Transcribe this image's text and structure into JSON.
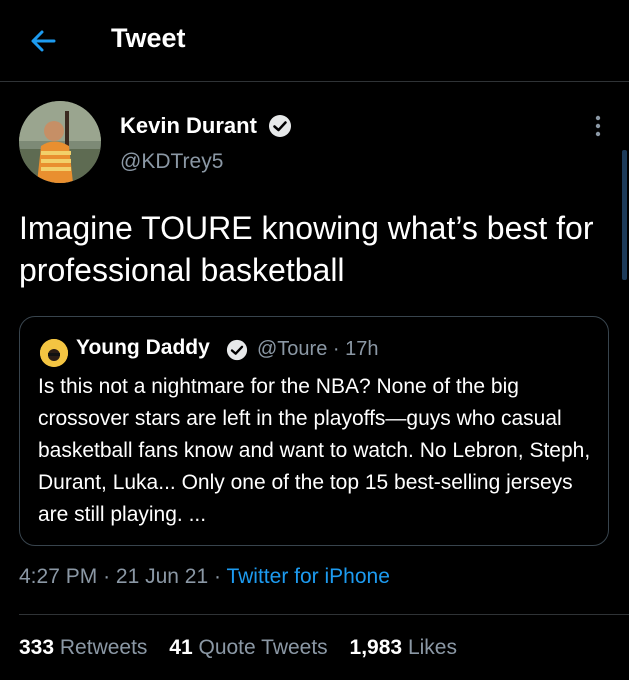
{
  "header": {
    "title": "Tweet",
    "back_icon": "arrow-left-icon",
    "accent_color": "#1d9bf0"
  },
  "author": {
    "name": "Kevin Durant",
    "handle": "@KDTrey5",
    "verified": true
  },
  "tweet": {
    "text": "Imagine TOURE knowing what’s best for professional basketball"
  },
  "quote": {
    "name": "Young Daddy",
    "verified": true,
    "handle": "@Toure",
    "separator": "·",
    "time": "17h",
    "text": "Is this not a nightmare for the NBA? None of the big crossover stars are left in the playoffs—guys who casual basketball fans know and want to watch. No Lebron, Steph, Durant, Luka... Only one of the top 15 best-selling jerseys are still playing. ..."
  },
  "meta": {
    "time": "4:27 PM",
    "separator": "·",
    "date": "21 Jun 21",
    "source": "Twitter for iPhone"
  },
  "stats": {
    "retweets_count": "333",
    "retweets_label": "Retweets",
    "quotes_count": "41",
    "quotes_label": "Quote Tweets",
    "likes_count": "1,983",
    "likes_label": "Likes"
  }
}
